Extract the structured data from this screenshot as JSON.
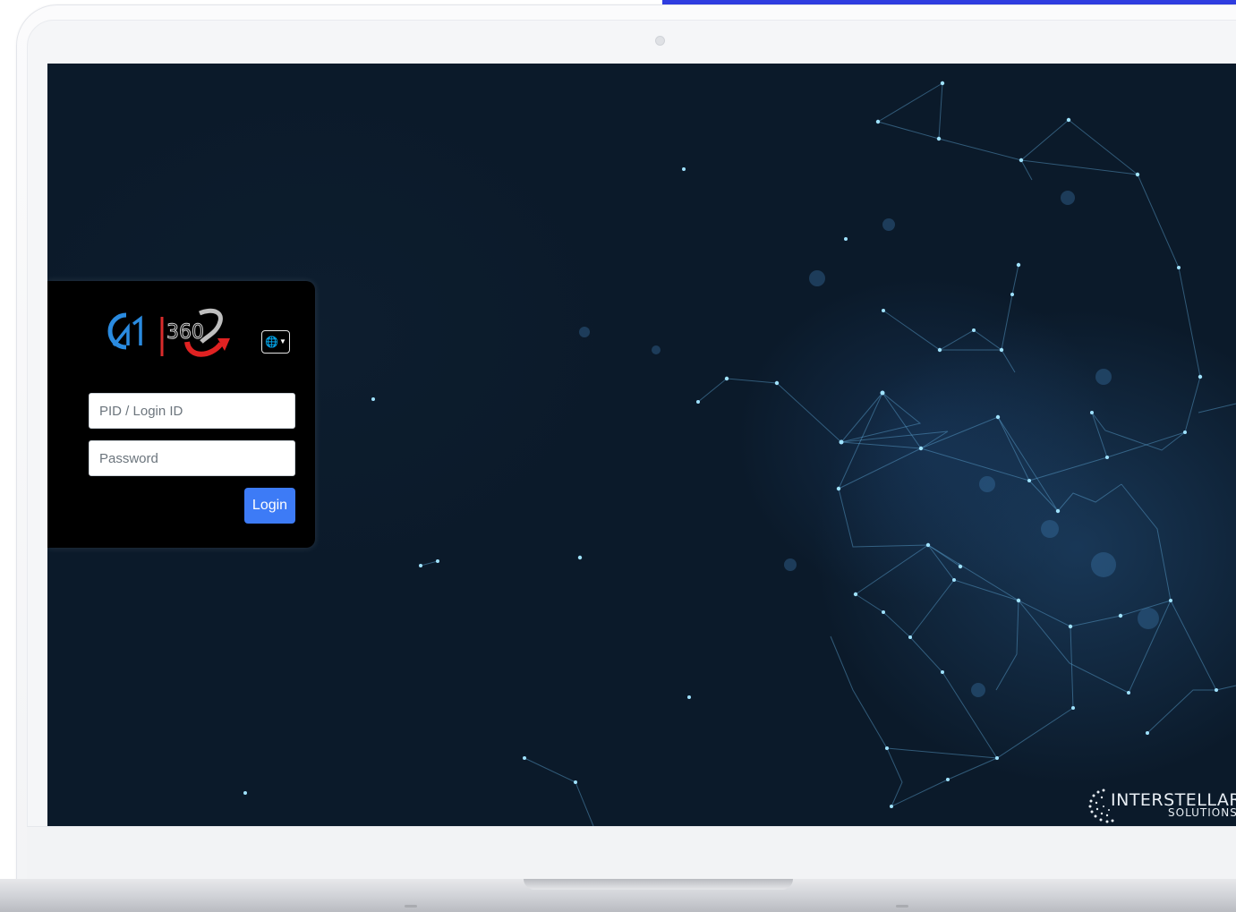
{
  "login": {
    "pid_placeholder": "PID / Login ID",
    "password_placeholder": "Password",
    "login_label": "Login",
    "logo_text": "G21 360",
    "language_icon": "globe-icon"
  },
  "footer_brand": {
    "name": "INTERSTELLAR",
    "tagline": "SOLUTIONS"
  },
  "colors": {
    "background": "#0b1a2a",
    "login_button": "#3d7bf6",
    "card": "#000000",
    "accent_bar": "#2f3de0"
  }
}
